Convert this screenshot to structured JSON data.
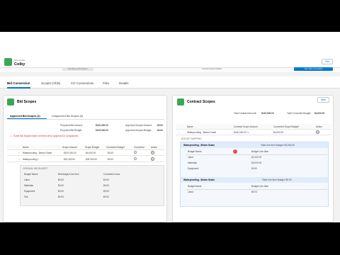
{
  "header": {
    "record_type": "Opportunity",
    "record_name": "Colby",
    "button_label": "Edit",
    "strip_a": "Pending Lumber Bueno",
    "strip_b": "Contract Scope Initiated",
    "strip_c": "View Tabs & Contracts"
  },
  "tabs": [
    "Bid Conversion",
    "Scopes (Vbls)",
    "CO Conversions",
    "Files",
    "Details"
  ],
  "left": {
    "title": "Bid Scopes",
    "subtabs": [
      "Approved Bid Scopes (2)",
      "Unapproved Bid Scopes (5)"
    ],
    "totals": [
      {
        "label": "Proposed Bid Amount:",
        "value": "$120,300.00"
      },
      {
        "label": "Proposed Bid Budget:",
        "value": "$125,300.00"
      }
    ],
    "totals_right": [
      {
        "label": "Approved Scopes Amount:",
        "value": "$0.00"
      },
      {
        "label": "Approved Scopes Budget:",
        "value": "$0.00"
      }
    ],
    "warning": "Some Bid Scopes have not been set to Approved or Unapproved",
    "columns": [
      "Name",
      "Scope Amount",
      "Scope Budget",
      "Converted Budget",
      "Converted",
      "Action"
    ],
    "rows": [
      {
        "name": "Waterproofing - Below Grade",
        "amount": "$100,000.00",
        "budget": "$4,000.00",
        "converted": "$0.00"
      },
      {
        "name": "Waterproofing 1",
        "amount": "$20,300.00",
        "budget": "$25,300.00",
        "converted": "$0.00"
      }
    ],
    "inner": {
      "title": "ORIGINAL BID BUDGET",
      "columns": [
        "Budget Name",
        "Bid Budget Line Item",
        "Converted Lines"
      ],
      "rows": [
        {
          "name": "Labor",
          "bid": "$0.00",
          "conv": "$0.00"
        },
        {
          "name": "Materials",
          "bid": "$0.00",
          "conv": "$0.00"
        },
        {
          "name": "Equipment",
          "bid": "$0.00",
          "conv": "$0.00"
        },
        {
          "name": "Sub",
          "bid": "$0.00",
          "conv": "$0.00"
        }
      ]
    }
  },
  "right": {
    "title": "Contract Scopes",
    "new_button": "New",
    "total_amount_label": "Total Contract Amount:",
    "total_amount": "$140,000.00",
    "total_budget_label": "Total Converted Budget:",
    "total_budget": "$4,000.00",
    "columns": [
      "Name",
      "Contract Scope Amount",
      "Converted Scope Budget",
      "Action"
    ],
    "row": {
      "name": "Waterproofing - Below Grade",
      "amount": "$140,000.00",
      "budget": "$4,000.00"
    },
    "mapping_label": "BUDGET MAPPING",
    "box1": {
      "title": "Waterproofing - Below Grade",
      "total": "Total Line Item Budget: $4,000.00",
      "columns": [
        "Budget Name",
        "Budget Line Item"
      ],
      "rows": [
        {
          "name": "Labor",
          "value": "$1,000.00"
        },
        {
          "name": "Materials",
          "value": "$3,000.00"
        },
        {
          "name": "Equipment",
          "value": "$0.00"
        }
      ]
    },
    "box2": {
      "title": "Waterproofing - Below Grade",
      "total": "Total Line Item Budget: $0.00",
      "columns": [
        "Budget Name",
        "Budget Line Item"
      ],
      "rows": [
        {
          "name": "Labor",
          "value": "$0.00"
        }
      ]
    }
  },
  "colors": {
    "accent": "#0176d3",
    "icon": "#3ba755",
    "warning": "#c23934"
  }
}
